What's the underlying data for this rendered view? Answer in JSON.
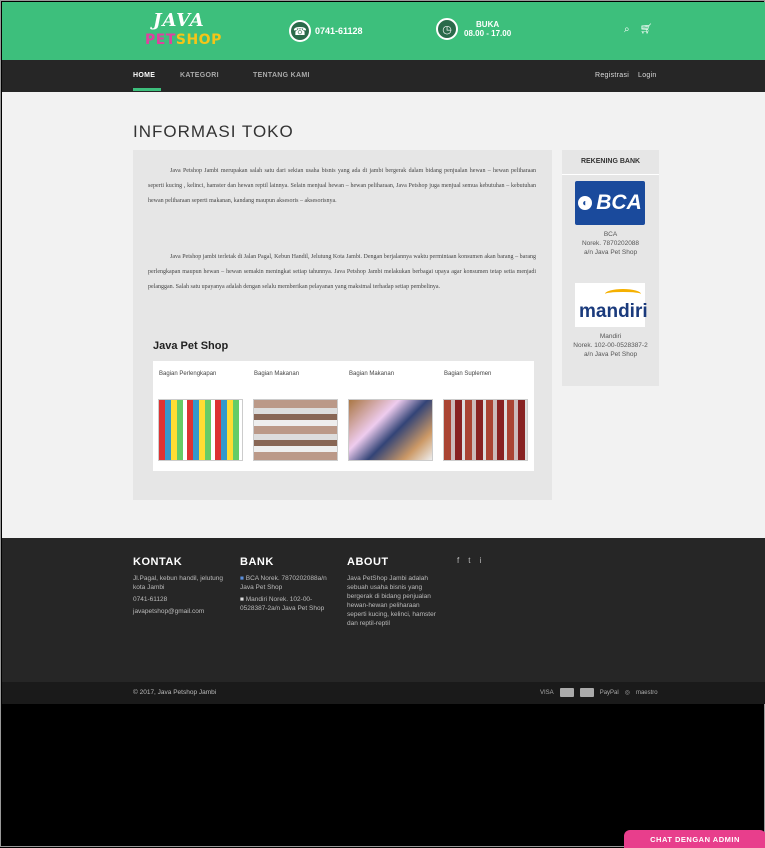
{
  "header": {
    "logo_line1": "JAVA",
    "logo_line2_a": "PET",
    "logo_line2_b": "SHOP",
    "phone": "0741-61128",
    "hours_label": "BUKA",
    "hours_value": "08.00 - 17.00",
    "search_icon": "search-icon",
    "cart_icon": "cart-icon",
    "accent_color": "#3dbf7c"
  },
  "nav": {
    "items": [
      "HOME",
      "KATEGORI",
      "TENTANG KAMI"
    ],
    "register": "Registrasi",
    "login": "Login"
  },
  "main": {
    "title": "INFORMASI TOKO",
    "para1": "Java Petshop Jambi merupakan salah satu dari sekian usaha bisnis yang ada di jambi bergerak dalam bidang penjualan hewan – hewan peliharaan seperti kucing , kelinci, hamster dan hewan reptil lainnya. Selain menjual hewan – hewan peliharaan, Java Petshop juga menjual semua kebutuhan – kebutuhan hewan peliharaan seperti makanan, kandang maupun aksesoris – aksesorisnya.",
    "para2": "Java Petshop jambi terletak di Jalan Pagal, Kebun Handil, Jelutung Kota Jambi. Dengan berjalannya waktu permintaan konsumen akan barang – barang perlengkapan maupun hewan – hewan semakin meningkat setiap tahunnya. Java Petshop Jambi melakukan berbagai upaya agar konsumen tetap setia menjadi pelanggan. Salah satu upayanya adalah dengan selalu memberikan pelayanan yang maksimal terhadap setiap pembelinya.",
    "shop_title": "Java Pet Shop",
    "gallery": [
      "Bagian Perlengkapan",
      "Bagian Makanan",
      "Bagian Makanan",
      "Bagian Suplemen"
    ]
  },
  "bank": {
    "heading": "REKENING BANK",
    "bca_logo": "BCA",
    "bca_info": [
      "BCA",
      "Norek. 7870202088",
      "a/n Java Pet Shop"
    ],
    "mandiri_logo": "mandiri",
    "mandiri_info": [
      "Mandiri",
      "Norek. 102-00-0528387-2",
      "a/n Java Pet Shop"
    ]
  },
  "footer": {
    "kontak_title": "KONTAK",
    "kontak": [
      "Jl.Pagal, kebun handil, jelutung kota Jambi",
      "0741-61128",
      "javapetshop@gmail.com"
    ],
    "bank_title": "BANK",
    "bank": [
      "BCA Norek. 7870202088a/n Java Pet Shop",
      "Mandiri Norek. 102-00-0528387-2a/n Java Pet Shop"
    ],
    "about_title": "ABOUT",
    "about": "Java PetShop Jambi adalah sebuah usaha bisnis yang bergerak di bidang penjualan hewan-hewan peliharaan seperti kucing, kelinci, hamster dan reptil-reptil",
    "social": [
      "f",
      "t",
      "i"
    ],
    "copyright": "© 2017, Java Petshop Jambi",
    "payments": [
      "VISA",
      "PayPal",
      "maestro"
    ]
  },
  "chat": {
    "label": "CHAT DENGAN ADMIN",
    "color": "#e83e8c"
  }
}
